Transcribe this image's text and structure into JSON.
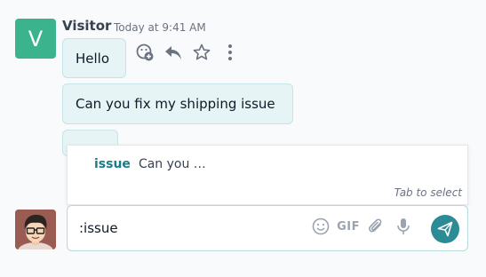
{
  "message_group": {
    "avatar_letter": "V",
    "author": "Visitor",
    "timestamp": "Today at 9:41 AM",
    "messages": [
      {
        "text": "Hello"
      },
      {
        "text": "Can you fix my shipping issue"
      },
      {
        "text": ""
      }
    ],
    "actions": [
      {
        "icon": "add-reaction-icon"
      },
      {
        "icon": "reply-icon"
      },
      {
        "icon": "star-icon"
      },
      {
        "icon": "more-options-icon"
      }
    ]
  },
  "suggestion": {
    "key": "issue",
    "preview": "Can you …",
    "hint": "Tab to select"
  },
  "composer": {
    "value": ":issue",
    "tools": [
      "emoji-icon",
      "gif-button",
      "attachment-icon",
      "microphone-icon"
    ],
    "gif_label": "GIF",
    "send_icon": "send-icon"
  },
  "colors": {
    "accent": "#2b8c95",
    "bubble_bg": "#e6f4f5",
    "visitor_avatar": "#3bb38d"
  }
}
